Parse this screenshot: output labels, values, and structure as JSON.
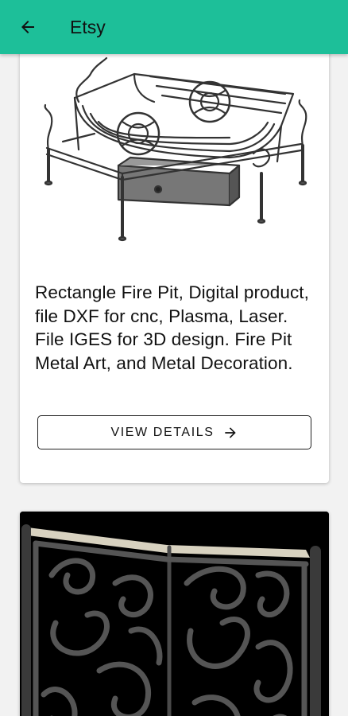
{
  "app_bar": {
    "title": "Etsy",
    "back_icon": "arrow-left-icon",
    "color": "#1dbf99"
  },
  "listings": [
    {
      "image": "rectangle-fire-pit-render",
      "description": "Rectangle Fire Pit, Digital product, file DXF for cnc, Plasma, Laser. File IGES for 3D design. Fire Pit Metal Art, and Metal Decoration.",
      "button_label": "VIEW DETAILS",
      "button_icon": "arrow-right-icon"
    },
    {
      "image": "ornamental-gate-render"
    }
  ]
}
